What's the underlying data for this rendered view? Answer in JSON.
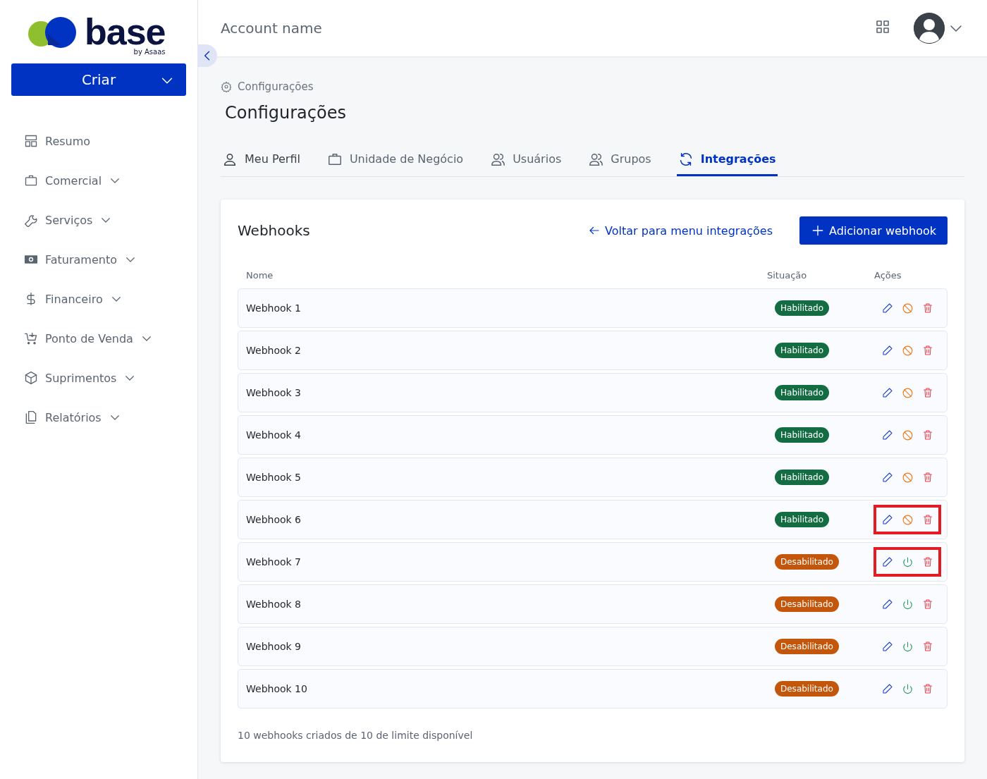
{
  "sidebar": {
    "logo": {
      "name": "base",
      "tagline": "by Asaas"
    },
    "create_button": "Criar",
    "items": [
      {
        "label": "Resumo",
        "expandable": false
      },
      {
        "label": "Comercial",
        "expandable": true
      },
      {
        "label": "Serviços",
        "expandable": true
      },
      {
        "label": "Faturamento",
        "expandable": true
      },
      {
        "label": "Financeiro",
        "expandable": true
      },
      {
        "label": "Ponto de Venda",
        "expandable": true
      },
      {
        "label": "Suprimentos",
        "expandable": true
      },
      {
        "label": "Relatórios",
        "expandable": true
      }
    ]
  },
  "header": {
    "account_name": "Account name"
  },
  "breadcrumb": "Configurações",
  "page_title": "Configurações",
  "tabs": [
    {
      "label": "Meu Perfil",
      "selected": false
    },
    {
      "label": "Unidade de Negócio",
      "selected": false
    },
    {
      "label": "Usuários",
      "selected": false
    },
    {
      "label": "Grupos",
      "selected": false
    },
    {
      "label": "Integrações",
      "selected": true
    }
  ],
  "webhooks": {
    "title": "Webhooks",
    "back_link": "Voltar para menu integrações",
    "add_button": "Adicionar webhook",
    "columns": [
      "Nome",
      "Situação",
      "Ações"
    ],
    "rows": [
      {
        "name": "Webhook 1",
        "status": "Habilitado",
        "kind": "enabled",
        "highlighted": false
      },
      {
        "name": "Webhook 2",
        "status": "Habilitado",
        "kind": "enabled",
        "highlighted": false
      },
      {
        "name": "Webhook 3",
        "status": "Habilitado",
        "kind": "enabled",
        "highlighted": false
      },
      {
        "name": "Webhook 4",
        "status": "Habilitado",
        "kind": "enabled",
        "highlighted": false
      },
      {
        "name": "Webhook 5",
        "status": "Habilitado",
        "kind": "enabled",
        "highlighted": false
      },
      {
        "name": "Webhook 6",
        "status": "Habilitado",
        "kind": "enabled",
        "highlighted": true
      },
      {
        "name": "Webhook 7",
        "status": "Desabilitado",
        "kind": "disabled",
        "highlighted": true
      },
      {
        "name": "Webhook 8",
        "status": "Desabilitado",
        "kind": "disabled",
        "highlighted": false
      },
      {
        "name": "Webhook 9",
        "status": "Desabilitado",
        "kind": "disabled",
        "highlighted": false
      },
      {
        "name": "Webhook 10",
        "status": "Desabilitado",
        "kind": "disabled",
        "highlighted": false
      }
    ],
    "footer": "10 webhooks criados de 10 de limite disponível"
  }
}
